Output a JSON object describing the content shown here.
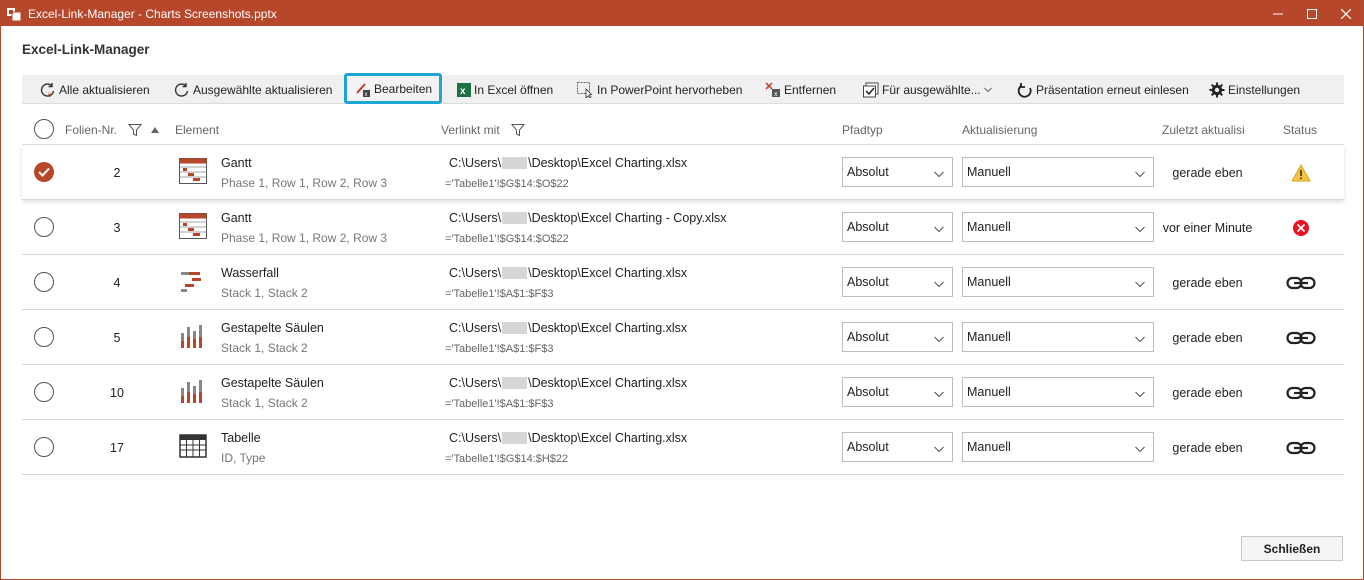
{
  "window": {
    "title": "Excel-Link-Manager - Charts Screenshots.pptx",
    "heading": "Excel-Link-Manager",
    "accent_color": "#b7472a",
    "highlight_color": "#1ba6d6"
  },
  "toolbar": {
    "update_all": "Alle aktualisieren",
    "update_selected": "Ausgewählte aktualisieren",
    "edit": "Bearbeiten",
    "open_in_excel": "In Excel öffnen",
    "highlight_in_ppt": "In PowerPoint hervorheben",
    "remove": "Entfernen",
    "for_selected": "Für ausgewählte...",
    "reload_presentation": "Präsentation erneut einlesen",
    "settings": "Einstellungen"
  },
  "columns": {
    "slide_no": "Folien-Nr.",
    "element": "Element",
    "linked_with": "Verlinkt mit",
    "path_type": "Pfadtyp",
    "update": "Aktualisierung",
    "last_updated": "Zuletzt aktualisi",
    "status": "Status"
  },
  "rows": [
    {
      "selected": true,
      "slide": "2",
      "icon": "gantt-icon",
      "name": "Gantt",
      "sub": "Phase 1, Row 1, Row 2, Row 3",
      "path_a": "C:\\Users\\",
      "path_b": "\\Desktop\\Excel Charting.xlsx",
      "range": "='Tabelle1'!$G$14:$O$22",
      "path_type": "Absolut",
      "update": "Manuell",
      "last": "gerade eben",
      "status": "warning-icon"
    },
    {
      "selected": false,
      "slide": "3",
      "icon": "gantt-icon",
      "name": "Gantt",
      "sub": "Phase 1, Row 1, Row 2, Row 3",
      "path_a": "C:\\Users\\",
      "path_b": "\\Desktop\\Excel Charting - Copy.xlsx",
      "range": "='Tabelle1'!$G$14:$O$22",
      "path_type": "Absolut",
      "update": "Manuell",
      "last": "vor einer Minute",
      "status": "error-icon"
    },
    {
      "selected": false,
      "slide": "4",
      "icon": "waterfall-icon",
      "name": "Wasserfall",
      "sub": "Stack 1, Stack 2",
      "path_a": "C:\\Users\\",
      "path_b": "\\Desktop\\Excel Charting.xlsx",
      "range": "='Tabelle1'!$A$1:$F$3",
      "path_type": "Absolut",
      "update": "Manuell",
      "last": "gerade eben",
      "status": "link-icon"
    },
    {
      "selected": false,
      "slide": "5",
      "icon": "stacked-column-icon",
      "name": "Gestapelte Säulen",
      "sub": "Stack 1, Stack 2",
      "path_a": "C:\\Users\\",
      "path_b": "\\Desktop\\Excel Charting.xlsx",
      "range": "='Tabelle1'!$A$1:$F$3",
      "path_type": "Absolut",
      "update": "Manuell",
      "last": "gerade eben",
      "status": "link-icon"
    },
    {
      "selected": false,
      "slide": "10",
      "icon": "stacked-column-icon",
      "name": "Gestapelte Säulen",
      "sub": "Stack 1, Stack 2",
      "path_a": "C:\\Users\\",
      "path_b": "\\Desktop\\Excel Charting.xlsx",
      "range": "='Tabelle1'!$A$1:$F$3",
      "path_type": "Absolut",
      "update": "Manuell",
      "last": "gerade eben",
      "status": "link-icon"
    },
    {
      "selected": false,
      "slide": "17",
      "icon": "table-icon",
      "name": "Tabelle",
      "sub": "ID, Type",
      "path_a": "C:\\Users\\",
      "path_b": "\\Desktop\\Excel Charting.xlsx",
      "range": "='Tabelle1'!$G$14:$H$22",
      "path_type": "Absolut",
      "update": "Manuell",
      "last": "gerade eben",
      "status": "link-icon"
    }
  ],
  "footer": {
    "close": "Schließen"
  }
}
